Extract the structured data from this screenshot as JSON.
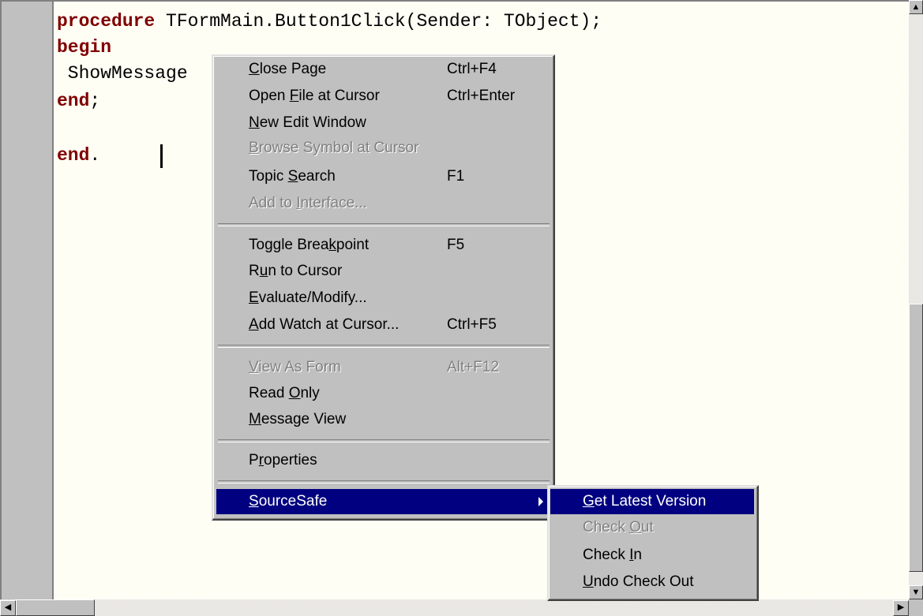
{
  "code_lines": {
    "line1": {
      "keyword": "procedure",
      "rest": " TFormMain.Button1Click(Sender: TObject);"
    },
    "line2": {
      "keyword": "begin"
    },
    "line3": {
      "text": " ShowMessage"
    },
    "line4": {
      "keyword": "end",
      "rest": ";"
    },
    "line6": {
      "keyword": "end",
      "rest": "."
    }
  },
  "context_menu": {
    "items": [
      {
        "pre": "",
        "u": "C",
        "post": "lose Page",
        "shortcut": "Ctrl+F4",
        "enabled": true
      },
      {
        "pre": "Open ",
        "u": "F",
        "post": "ile at Cursor",
        "shortcut": "Ctrl+Enter",
        "enabled": true
      },
      {
        "pre": "",
        "u": "N",
        "post": "ew Edit Window",
        "shortcut": "",
        "enabled": true
      },
      {
        "pre": "",
        "u": "B",
        "post": "rowse Symbol at Cursor",
        "shortcut": "",
        "enabled": false
      },
      {
        "pre": "Topic ",
        "u": "S",
        "post": "earch",
        "shortcut": "F1",
        "enabled": true
      },
      {
        "pre": "Add to ",
        "u": "I",
        "post": "nterface...",
        "shortcut": "",
        "enabled": false
      },
      {
        "pre": "Toggle Brea",
        "u": "k",
        "post": "point",
        "shortcut": "F5",
        "enabled": true
      },
      {
        "pre": "R",
        "u": "u",
        "post": "n to Cursor",
        "shortcut": "",
        "enabled": true
      },
      {
        "pre": "",
        "u": "E",
        "post": "valuate/Modify...",
        "shortcut": "",
        "enabled": true
      },
      {
        "pre": "",
        "u": "A",
        "post": "dd Watch at Cursor...",
        "shortcut": "Ctrl+F5",
        "enabled": true
      },
      {
        "pre": "",
        "u": "V",
        "post": "iew As Form",
        "shortcut": "Alt+F12",
        "enabled": false
      },
      {
        "pre": "Read ",
        "u": "O",
        "post": "nly",
        "shortcut": "",
        "enabled": true
      },
      {
        "pre": "",
        "u": "M",
        "post": "essage View",
        "shortcut": "",
        "enabled": true
      },
      {
        "pre": "P",
        "u": "r",
        "post": "operties",
        "shortcut": "",
        "enabled": true
      },
      {
        "pre": "",
        "u": "S",
        "post": "ourceSafe",
        "shortcut": "",
        "enabled": true,
        "highlighted": true
      }
    ]
  },
  "submenu_sourcesafe": {
    "items": [
      {
        "pre": "",
        "u": "G",
        "post": "et Latest Version",
        "enabled": true,
        "highlighted": true
      },
      {
        "pre": "Check ",
        "u": "O",
        "post": "ut",
        "enabled": false
      },
      {
        "pre": "Check ",
        "u": "I",
        "post": "n",
        "enabled": true
      },
      {
        "pre": "",
        "u": "U",
        "post": "ndo Check Out",
        "enabled": true
      }
    ]
  },
  "icons": {
    "scroll_up": "scroll-up-arrow-icon",
    "scroll_down": "scroll-down-arrow-icon",
    "scroll_left": "scroll-left-arrow-icon",
    "scroll_right": "scroll-right-arrow-icon",
    "submenu_arrow": "submenu-arrow-icon"
  },
  "colors": {
    "keyword": "#800000",
    "editor_bg": "#fffef5",
    "menu_bg": "#c0c0c0",
    "highlight": "#000080",
    "disabled_text": "#808080"
  }
}
